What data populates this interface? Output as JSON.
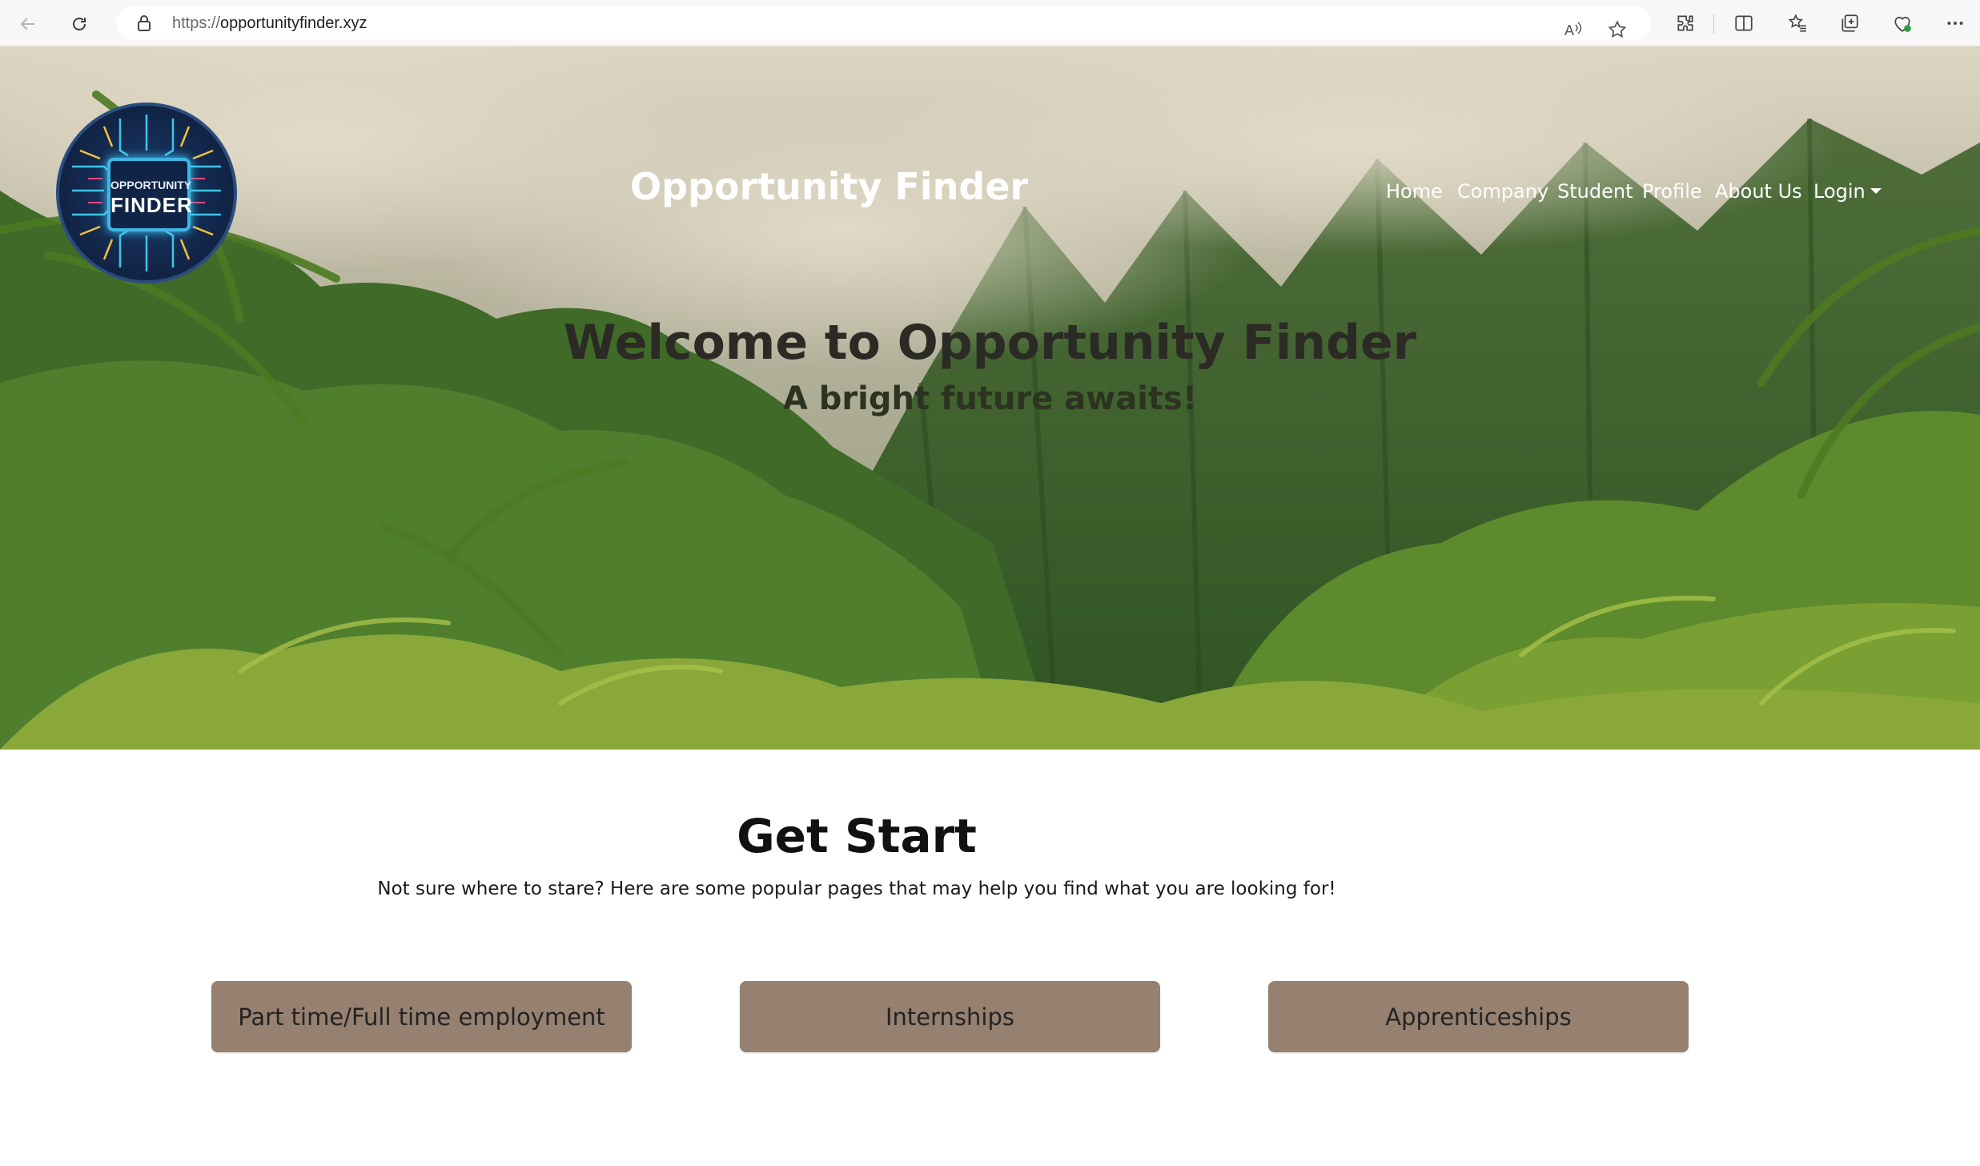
{
  "browser": {
    "url_protocol": "https://",
    "url_host": "opportunityfinder.xyz",
    "icons": [
      "back-icon",
      "refresh-icon",
      "lock-icon",
      "read-aloud-icon",
      "favorite-star-icon",
      "extensions-icon",
      "split-screen-icon",
      "favorites-icon",
      "collections-icon",
      "browser-essentials-icon",
      "more-icon"
    ]
  },
  "header": {
    "logo_line1": "OPPORTUNITY",
    "logo_line2": "FINDER",
    "site_title": "Opportunity Finder",
    "nav": [
      {
        "label": "Home"
      },
      {
        "label": "Company"
      },
      {
        "label": "Student"
      },
      {
        "label": "Profile"
      },
      {
        "label": "About Us"
      },
      {
        "label": "Login"
      }
    ]
  },
  "hero": {
    "heading": "Welcome to Opportunity Finder",
    "subheading": "A bright future awaits!"
  },
  "get_start": {
    "title": "Get Start",
    "description": "Not sure where to stare? Here are some popular pages that may help you find what you are looking for!",
    "buttons": [
      {
        "label": "Part time/Full time employment"
      },
      {
        "label": "Internships"
      },
      {
        "label": "Apprenticeships"
      }
    ]
  },
  "colors": {
    "button_bg": "#968070",
    "hero_heading": "#2c2a24"
  }
}
